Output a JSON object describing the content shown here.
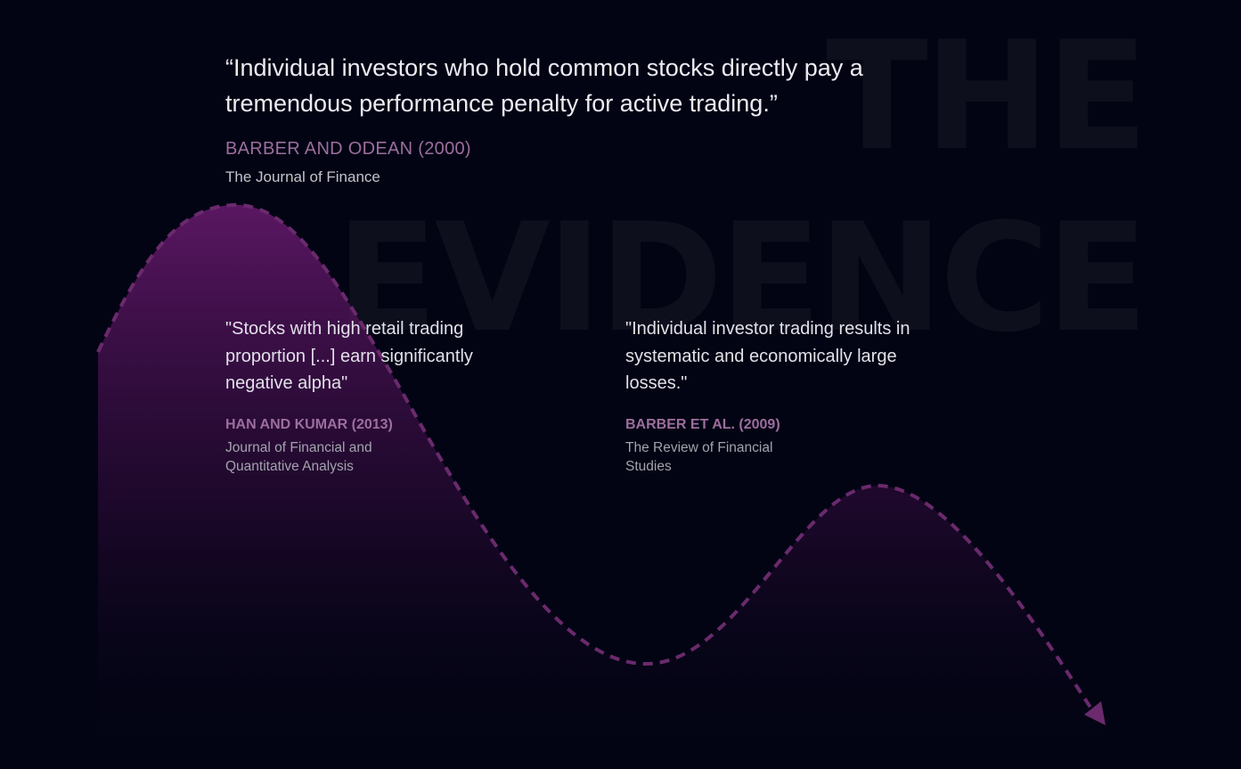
{
  "background_title": {
    "line1": "THE",
    "line2": "EVIDENCE"
  },
  "main_quote": {
    "text": "“Individual investors who hold common stocks directly pay a tremendous performance penalty for active trading.”",
    "author": "BARBER AND ODEAN (2000)",
    "journal": "The Journal of Finance"
  },
  "quotes": [
    {
      "text": "\"Stocks with high retail trading proportion [...] earn significantly negative alpha\"",
      "author": "HAN AND KUMAR (2013)",
      "journal": "Journal of Financial and Quantitative Analysis"
    },
    {
      "text": "\"Individual investor trading results in systematic and economically large losses.\"",
      "author": "BARBER ET AL. (2009)",
      "journal": "The Review of Financial Studies"
    }
  ],
  "colors": {
    "background": "#020413",
    "accent": "#9c6e9e",
    "curve": "#6a2a6c"
  }
}
